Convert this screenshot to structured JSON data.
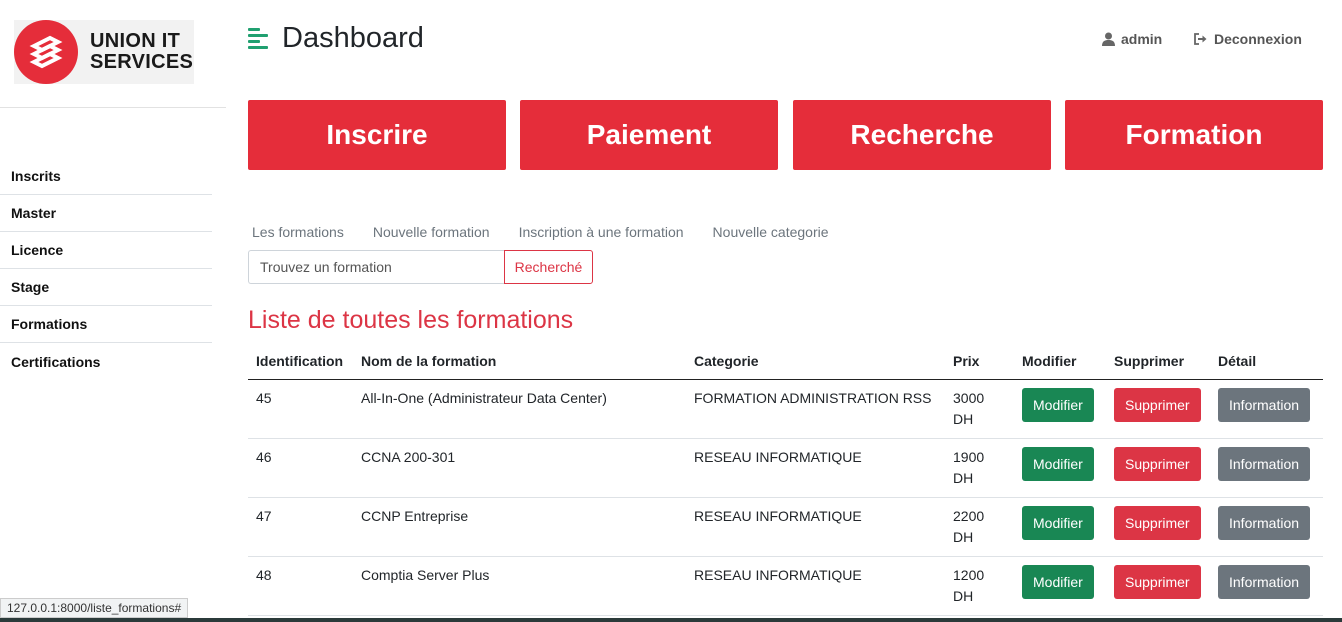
{
  "brand": {
    "name_line1": "UNION IT",
    "name_line2": "SERVICES",
    "accent": "#e52d3a"
  },
  "sidebar": {
    "items": [
      {
        "label": "Inscrits"
      },
      {
        "label": "Master"
      },
      {
        "label": "Licence"
      },
      {
        "label": "Stage"
      },
      {
        "label": "Formations"
      },
      {
        "label": "Certifications"
      }
    ]
  },
  "header": {
    "title": "Dashboard",
    "menu_icon": "hamburger-icon",
    "user_label": "admin",
    "user_icon": "user-icon",
    "logout_label": "Deconnexion",
    "logout_icon": "sign-out-icon"
  },
  "tiles": [
    {
      "label": "Inscrire"
    },
    {
      "label": "Paiement"
    },
    {
      "label": "Recherche"
    },
    {
      "label": "Formation"
    }
  ],
  "subnav": [
    {
      "label": "Les formations"
    },
    {
      "label": "Nouvelle formation"
    },
    {
      "label": "Inscription à une formation"
    },
    {
      "label": "Nouvelle categorie"
    }
  ],
  "search": {
    "placeholder": "Trouvez un formation",
    "button_label": "Recherché"
  },
  "list_title": "Liste de toutes les formations",
  "table": {
    "headers": {
      "id": "Identification",
      "name": "Nom de la formation",
      "category": "Categorie",
      "price": "Prix",
      "edit": "Modifier",
      "delete": "Supprimer",
      "detail": "Détail"
    },
    "rows": [
      {
        "id": "45",
        "name": "All-In-One (Administrateur Data Center)",
        "category": "FORMATION ADMINISTRATION RSS",
        "price": "3000",
        "currency": "DH",
        "edit": "Modifier",
        "delete": "Supprimer",
        "detail": "Information"
      },
      {
        "id": "46",
        "name": "CCNA 200-301",
        "category": "RESEAU INFORMATIQUE",
        "price": "1900",
        "currency": "DH",
        "edit": "Modifier",
        "delete": "Supprimer",
        "detail": "Information"
      },
      {
        "id": "47",
        "name": "CCNP Entreprise",
        "category": "RESEAU INFORMATIQUE",
        "price": "2200",
        "currency": "DH",
        "edit": "Modifier",
        "delete": "Supprimer",
        "detail": "Information"
      },
      {
        "id": "48",
        "name": "Comptia Server Plus",
        "category": "RESEAU INFORMATIQUE",
        "price": "1200",
        "currency": "DH",
        "edit": "Modifier",
        "delete": "Supprimer",
        "detail": "Information"
      }
    ]
  },
  "status_url": "127.0.0.1:8000/liste_formations#"
}
